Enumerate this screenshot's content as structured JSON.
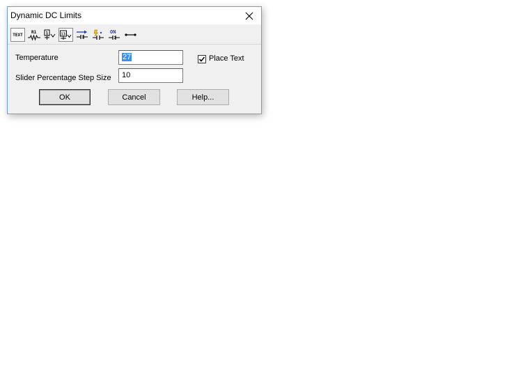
{
  "dialog": {
    "title": "Dynamic DC Limits",
    "close_icon": "close-icon"
  },
  "toolbar": {
    "buttons": [
      {
        "name": "text-mode",
        "label": "TEXT",
        "pressed": true
      },
      {
        "name": "resistor-value",
        "label": "R1",
        "pressed": false
      },
      {
        "name": "node-voltage",
        "label": "1",
        "pressed": false
      },
      {
        "name": "node-voltage-alt",
        "label": "13",
        "pressed": true
      },
      {
        "name": "current-flow",
        "label": "",
        "pressed": false
      },
      {
        "name": "power-dissipation",
        "label": "",
        "pressed": false
      },
      {
        "name": "switch-state",
        "label": "ON",
        "pressed": false
      },
      {
        "name": "pin-connection",
        "label": "",
        "pressed": false
      }
    ]
  },
  "form": {
    "temperature_label": "Temperature",
    "temperature_value": "27",
    "step_size_label": "Slider Percentage Step Size",
    "step_size_value": "10",
    "place_text_label": "Place Text",
    "place_text_checked": true
  },
  "buttons": {
    "ok": "OK",
    "cancel": "Cancel",
    "help": "Help..."
  },
  "colors": {
    "selection": "#3390ff",
    "window_border": "#6aa0d8",
    "dialog_bg": "#f0f0f0",
    "arrow_blue": "#1a3ccf",
    "toolbar_accent": "#f0c000"
  }
}
